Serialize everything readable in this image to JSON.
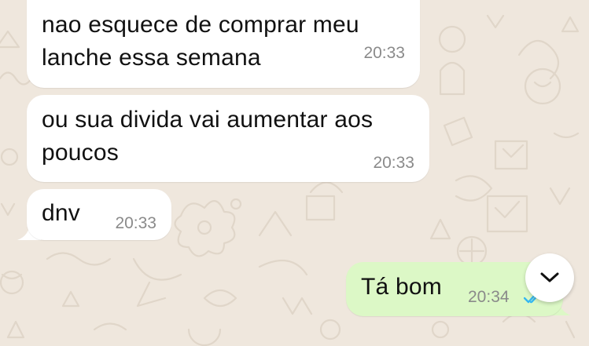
{
  "chat": {
    "messages": [
      {
        "direction": "incoming",
        "text": "nao esquece de comprar meu\nlanche essa semana",
        "time": "20:33"
      },
      {
        "direction": "incoming",
        "text": "ou sua divida vai aumentar aos\npoucos",
        "time": "20:33"
      },
      {
        "direction": "incoming",
        "text": "dnv",
        "time": "20:33"
      },
      {
        "direction": "outgoing",
        "text": "Tá bom",
        "time": "20:34",
        "status": "read"
      }
    ]
  },
  "scroll_button": {
    "icon": "chevron-down-icon"
  },
  "colors": {
    "wallpaper": "#efe7dd",
    "incoming_bubble": "#ffffff",
    "outgoing_bubble": "#dcf8c6",
    "read_ticks": "#34b7f1",
    "timestamp": "#8a8a8a"
  }
}
